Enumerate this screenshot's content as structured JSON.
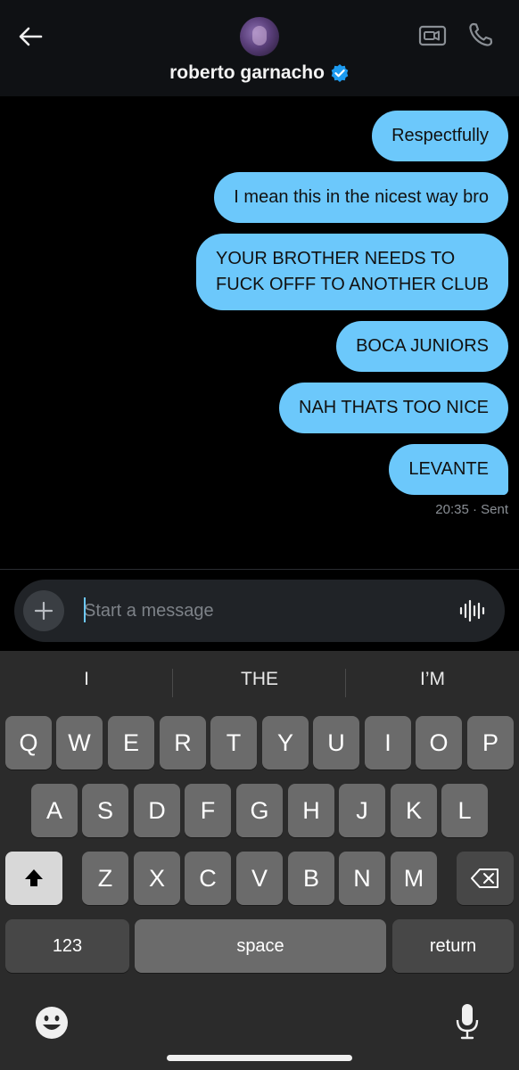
{
  "header": {
    "title": "roberto garnacho",
    "back_icon": "back-arrow-icon",
    "video_icon": "video-call-icon",
    "call_icon": "phone-icon",
    "verified_icon": "verified-badge-icon",
    "accent": "#1d9bf0"
  },
  "messages": [
    {
      "text": "Respectfully"
    },
    {
      "text": "I mean this in the nicest way bro"
    },
    {
      "text": "YOUR BROTHER NEEDS TO\nFUCK OFFF TO ANOTHER CLUB"
    },
    {
      "text": "BOCA JUNIORS"
    },
    {
      "text": "NAH THATS TOO NICE"
    },
    {
      "text": "LEVANTE"
    }
  ],
  "message_meta": "20:35 · Sent",
  "bubble_color": "#6cc8fb",
  "composer": {
    "placeholder": "Start a message",
    "add_icon": "plus-icon",
    "voice_icon": "voice-waveform-icon"
  },
  "keyboard": {
    "suggestions": [
      "I",
      "THE",
      "I’M"
    ],
    "row1": [
      "Q",
      "W",
      "E",
      "R",
      "T",
      "Y",
      "U",
      "I",
      "O",
      "P"
    ],
    "row2": [
      "A",
      "S",
      "D",
      "F",
      "G",
      "H",
      "J",
      "K",
      "L"
    ],
    "row3": [
      "Z",
      "X",
      "C",
      "V",
      "B",
      "N",
      "M"
    ],
    "numbers_label": "123",
    "space_label": "space",
    "return_label": "return",
    "shift_icon": "shift-icon",
    "delete_icon": "backspace-icon",
    "emoji_icon": "emoji-icon",
    "mic_icon": "microphone-icon"
  }
}
